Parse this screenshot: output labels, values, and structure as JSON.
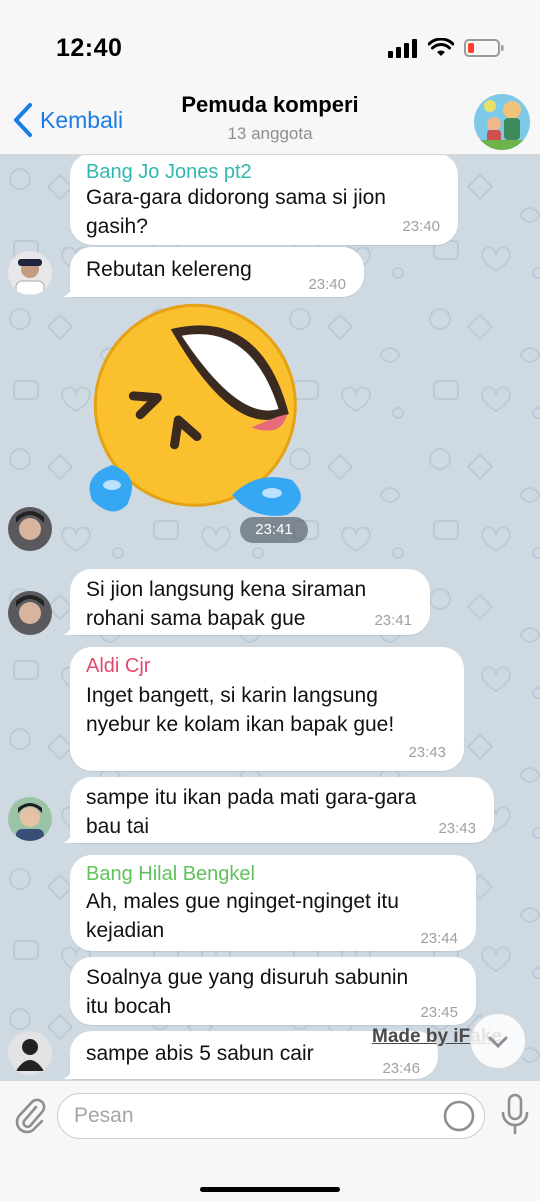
{
  "status_bar": {
    "time": "12:40"
  },
  "nav": {
    "back_label": "Kembali",
    "title": "Pemuda komperi",
    "subtitle": "13 anggota"
  },
  "messages": [
    {
      "sender": "Bang Jo Jones pt2",
      "sender_color": "#2fb8b0",
      "text": "Gara-gara didorong sama si jion\ngasih?",
      "time": "23:40"
    },
    {
      "text": "Rebutan kelereng",
      "time": "23:40"
    },
    {
      "sticker": "rolling-on-floor-laughing-emoji",
      "time": "23:41"
    },
    {
      "text": "Si jion langsung kena siraman\nrohani sama bapak gue",
      "time": "23:41"
    },
    {
      "sender": "Aldi Cjr",
      "sender_color": "#e5486d",
      "text": "Inget bangett, si karin langsung\nnyebur ke kolam ikan bapak gue!",
      "time": "23:43"
    },
    {
      "text": "sampe itu ikan pada mati gara-gara\nbau tai",
      "time": "23:43"
    },
    {
      "sender": "Bang Hilal Bengkel",
      "sender_color": "#5fc25c",
      "text": "Ah, males gue nginget-nginget itu\nkejadian",
      "time": "23:44"
    },
    {
      "text": "Soalnya gue yang disuruh sabunin\nitu bocah",
      "time": "23:45"
    },
    {
      "text": "sampe abis 5 sabun cair",
      "time": "23:46"
    }
  ],
  "watermark": "Made by iFake",
  "input": {
    "placeholder": "Pesan",
    "value": ""
  },
  "colors": {
    "accent": "#1b7ce8",
    "chat_bg": "#cfd9e2",
    "bubble": "#ffffff"
  }
}
